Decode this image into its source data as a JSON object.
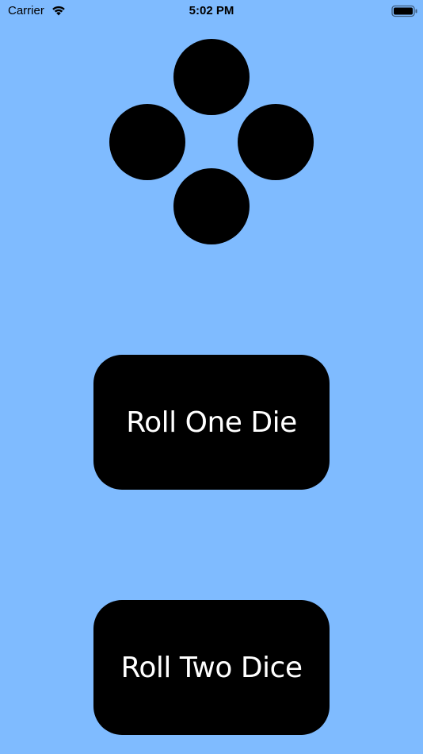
{
  "status_bar": {
    "carrier": "Carrier",
    "time": "5:02 PM",
    "wifi_icon": "wifi-icon",
    "battery_icon": "battery-icon"
  },
  "die": {
    "face_value": 4,
    "pip_color": "#000000"
  },
  "buttons": {
    "roll_one_label": "Roll One Die",
    "roll_two_label": "Roll Two Dice"
  },
  "colors": {
    "background": "#7fbbff",
    "button_background": "#000000",
    "button_text": "#ffffff"
  }
}
